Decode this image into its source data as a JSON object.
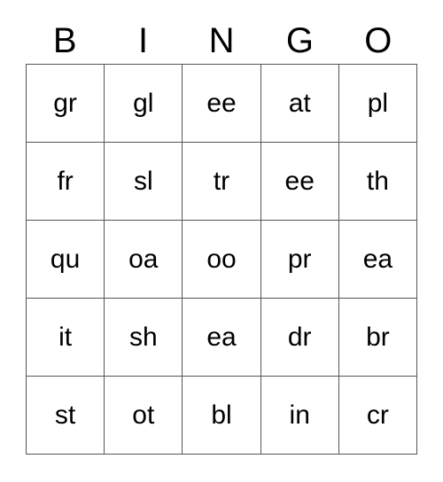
{
  "card": {
    "title": "BINGO",
    "columns": [
      "B",
      "I",
      "N",
      "G",
      "O"
    ],
    "rows": [
      [
        "gr",
        "gl",
        "ee",
        "at",
        "pl"
      ],
      [
        "fr",
        "sl",
        "tr",
        "ee",
        "th"
      ],
      [
        "qu",
        "oa",
        "oo",
        "pr",
        "ea"
      ],
      [
        "it",
        "sh",
        "ea",
        "dr",
        "br"
      ],
      [
        "st",
        "ot",
        "bl",
        "in",
        "cr"
      ]
    ],
    "colors": {
      "background": "#ffffff",
      "text": "#000000",
      "grid_line": "#555555"
    }
  }
}
